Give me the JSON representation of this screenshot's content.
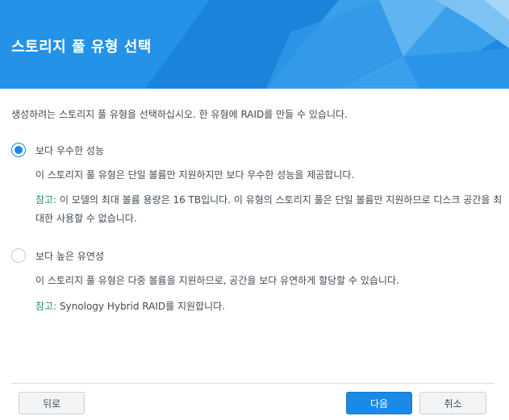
{
  "header": {
    "title": "스토리지 풀 유형 선택",
    "background_color": "#1e8ae0"
  },
  "intro_text": "생성하려는 스토리지 풀 유형을 선택하십시오. 한 유형에 RAID를 만들 수 있습니다.",
  "options": [
    {
      "label": "보다 우수한 성능",
      "selected": true,
      "description": "이 스토리지 풀 유형은 단일 볼륨만 지원하지만 보다 우수한 성능을 제공합니다.",
      "note_prefix": "참고:",
      "note_text": " 이 모델의 최대 볼륨 용량은 16 TB입니다. 이 유형의 스토리지 풀은 단일 볼륨만 지원하므로 디스크 공간을 최대한 사용할 수 없습니다."
    },
    {
      "label": "보다 높은 유연성",
      "selected": false,
      "description": "이 스토리지 풀 유형은 다중 볼륨을 지원하므로, 공간을 보다 유연하게 할당할 수 있습니다.",
      "note_prefix": "참고:",
      "note_text": " Synology Hybrid RAID를 지원합니다."
    }
  ],
  "footer": {
    "back_label": "뒤로",
    "next_label": "다음",
    "cancel_label": "취소"
  },
  "colors": {
    "accent": "#1a8ae6",
    "note_green": "#1d9a5a",
    "text": "#414b55"
  }
}
